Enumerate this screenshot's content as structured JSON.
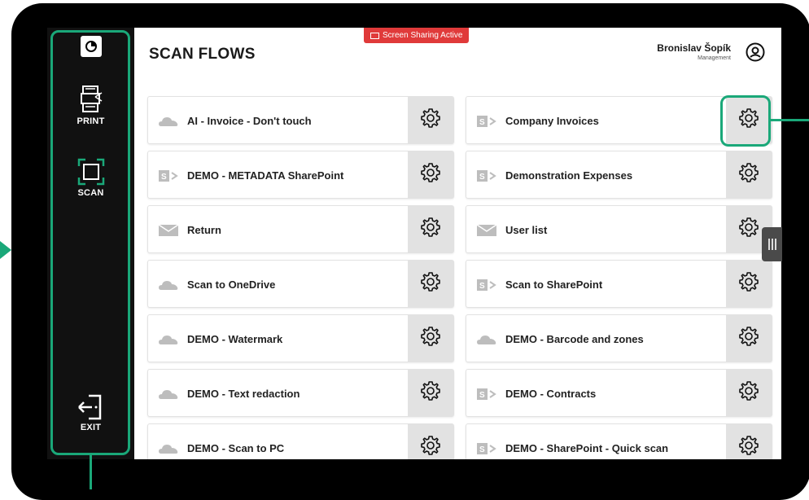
{
  "header": {
    "title": "SCAN FLOWS",
    "sharing_badge": "Screen Sharing Active",
    "user_name": "Bronislav Šopík",
    "user_role": "Management"
  },
  "sidebar": {
    "print_label": "PRINT",
    "scan_label": "SCAN",
    "exit_label": "EXIT"
  },
  "flows": [
    {
      "label": "AI - Invoice - Don't touch",
      "icon": "cloud-icon"
    },
    {
      "label": "Company Invoices",
      "icon": "sharepoint-icon"
    },
    {
      "label": "DEMO - METADATA SharePoint",
      "icon": "sharepoint-icon"
    },
    {
      "label": "Demonstration Expenses",
      "icon": "sharepoint-icon"
    },
    {
      "label": "Return",
      "icon": "mail-icon"
    },
    {
      "label": "User list",
      "icon": "mail-icon"
    },
    {
      "label": "Scan to OneDrive",
      "icon": "cloud-icon"
    },
    {
      "label": "Scan to SharePoint",
      "icon": "sharepoint-icon"
    },
    {
      "label": "DEMO - Watermark",
      "icon": "cloud-icon"
    },
    {
      "label": "DEMO - Barcode and zones",
      "icon": "cloud-icon"
    },
    {
      "label": "DEMO - Text redaction",
      "icon": "cloud-icon"
    },
    {
      "label": "DEMO - Contracts",
      "icon": "sharepoint-icon"
    },
    {
      "label": "DEMO - Scan to PC",
      "icon": "cloud-icon"
    },
    {
      "label": "DEMO - SharePoint - Quick scan",
      "icon": "sharepoint-icon"
    }
  ],
  "colors": {
    "accent": "#1aa879",
    "badge": "#e03a3a",
    "sidebar": "#111111"
  }
}
